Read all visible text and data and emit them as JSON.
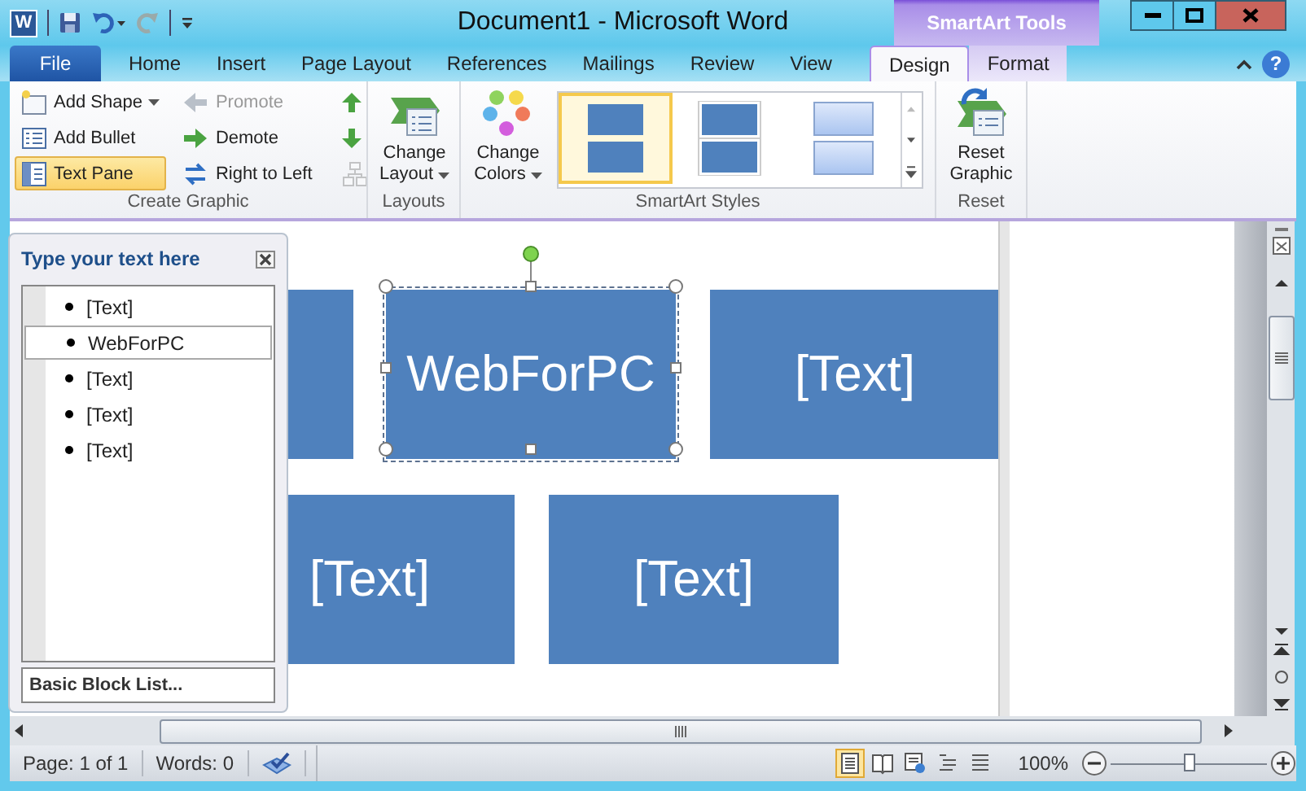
{
  "window": {
    "app_icon": "W",
    "title": "Document1  -  Microsoft Word",
    "contextual_group": "SmartArt Tools",
    "help": "?"
  },
  "tabs": [
    {
      "label": "File",
      "kind": "file",
      "selected": false
    },
    {
      "label": "Home",
      "kind": "normal",
      "selected": false
    },
    {
      "label": "Insert",
      "kind": "normal",
      "selected": false
    },
    {
      "label": "Page Layout",
      "kind": "normal",
      "selected": false
    },
    {
      "label": "References",
      "kind": "normal",
      "selected": false
    },
    {
      "label": "Mailings",
      "kind": "normal",
      "selected": false
    },
    {
      "label": "Review",
      "kind": "normal",
      "selected": false
    },
    {
      "label": "View",
      "kind": "normal",
      "selected": false
    },
    {
      "label": "Design",
      "kind": "contextual",
      "selected": true
    },
    {
      "label": "Format",
      "kind": "contextual",
      "selected": false
    }
  ],
  "ribbon": {
    "create_graphic": {
      "label": "Create Graphic",
      "buttons": [
        {
          "label": "Add Shape",
          "dropdown": true,
          "disabled": false,
          "selected": false
        },
        {
          "label": "Add Bullet",
          "dropdown": false,
          "disabled": false,
          "selected": false
        },
        {
          "label": "Text Pane",
          "dropdown": false,
          "disabled": false,
          "selected": true
        },
        {
          "label": "Promote",
          "dropdown": false,
          "disabled": true,
          "selected": false
        },
        {
          "label": "Demote",
          "dropdown": false,
          "disabled": false,
          "selected": false
        },
        {
          "label": "Right to Left",
          "dropdown": false,
          "disabled": false,
          "selected": false
        }
      ],
      "icon_buttons": [
        {
          "disabled": false
        },
        {
          "disabled": false
        },
        {
          "disabled": true
        }
      ]
    },
    "layouts": {
      "label": "Layouts",
      "button": "Change Layout"
    },
    "styles": {
      "label": "SmartArt Styles",
      "button": "Change Colors",
      "gallery": [
        {
          "kind": "plain",
          "selected": true
        },
        {
          "kind": "outlined",
          "selected": false
        },
        {
          "kind": "gradient",
          "selected": false
        }
      ]
    },
    "reset": {
      "label": "Reset",
      "button": "Reset Graphic"
    }
  },
  "text_pane": {
    "title": "Type your text here",
    "items": [
      {
        "text": "[Text]",
        "selected": false
      },
      {
        "text": "WebForPC",
        "selected": true
      },
      {
        "text": "[Text]",
        "selected": false
      },
      {
        "text": "[Text]",
        "selected": false
      },
      {
        "text": "[Text]",
        "selected": false
      }
    ],
    "footer": "Basic Block List..."
  },
  "diagram": {
    "shapes": [
      {
        "selected": false
      },
      {
        "text": "WebForPC",
        "selected": true
      },
      {
        "text": "[Text]",
        "selected": false
      },
      {
        "text": "[Text]",
        "selected": false
      },
      {
        "text": "[Text]",
        "selected": false
      }
    ]
  },
  "status_bar": {
    "page": "Page: 1 of 1",
    "words": "Words: 0",
    "views": [
      {
        "selected": true
      },
      {
        "selected": false
      },
      {
        "selected": false
      },
      {
        "selected": false
      },
      {
        "selected": false
      }
    ],
    "zoom": "100%",
    "zoom_slider": {
      "level": 0.5
    }
  }
}
